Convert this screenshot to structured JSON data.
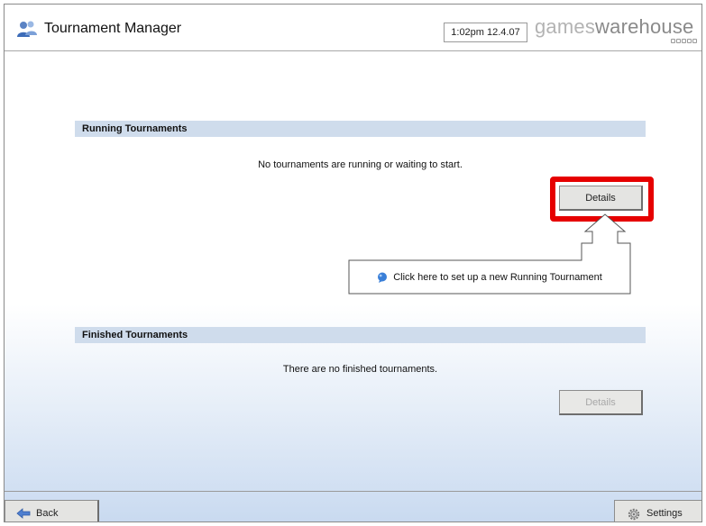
{
  "header": {
    "app_title": "Tournament Manager",
    "datetime": "1:02pm 12.4.07",
    "brand_part1": "games",
    "brand_part2": "warehouse"
  },
  "running": {
    "section_title": "Running Tournaments",
    "empty_message": "No tournaments are running or waiting to start.",
    "details_label": "Details"
  },
  "callout": {
    "text": "Click here to set up a new Running Tournament",
    "icon": "speech-bubble-icon"
  },
  "finished": {
    "section_title": "Finished Tournaments",
    "empty_message": "There are no finished tournaments.",
    "details_label": "Details"
  },
  "footer": {
    "back_label": "Back",
    "settings_label": "Settings"
  },
  "colors": {
    "highlight": "#e60000",
    "section_bar": "#cfdcec",
    "gradient_bottom": "#c9daf0"
  },
  "icons": {
    "app": "users-icon",
    "back": "arrow-left-icon",
    "settings": "gear-icon"
  }
}
